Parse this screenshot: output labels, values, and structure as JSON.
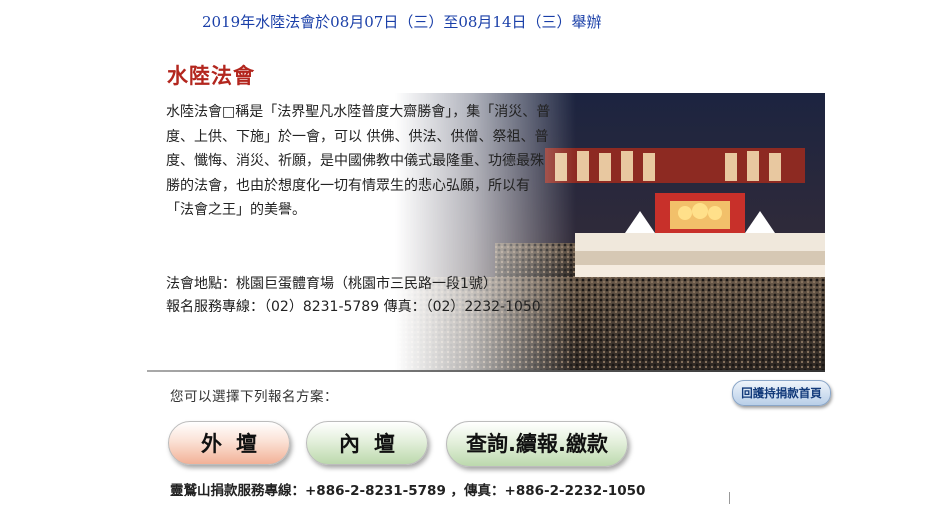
{
  "notice": "2019年水陸法會於08月07日（三）至08月14日（三）舉辦",
  "title": "水陸法會",
  "description": "水陸法會□稱是「法界聖凡水陸普度大齋勝會」，集「消災、普度、上供、下施」於一會，可以 供佛、供法、供僧、祭祖、普度、懺悔、消災、祈願，是中國佛教中儀式最隆重、功德最殊勝的法會，也由於想度化一切有情眾生的悲心弘願，所以有「法會之王」的美譽。",
  "location": "法會地點：桃園巨蛋體育場（桃園市三民路一段1號）",
  "phone": "報名服務專線：（02）8231-5789  傳真：（02）2232-1050",
  "choose_text": "您可以選擇下列報名方案：",
  "home_button": "回護持捐款首頁",
  "buttons": {
    "outer": "外壇",
    "inner": "內壇",
    "query": "查詢.續報.繳款"
  },
  "hotline": {
    "label": "靈鷲山捐款服務專線：",
    "value": "+886-2-8231-5789 ，傳真：+886-2-2232-1050"
  },
  "colors": {
    "title": "#b3261e",
    "notice": "#1a3fa8",
    "home_button_text": "#123a7a"
  }
}
